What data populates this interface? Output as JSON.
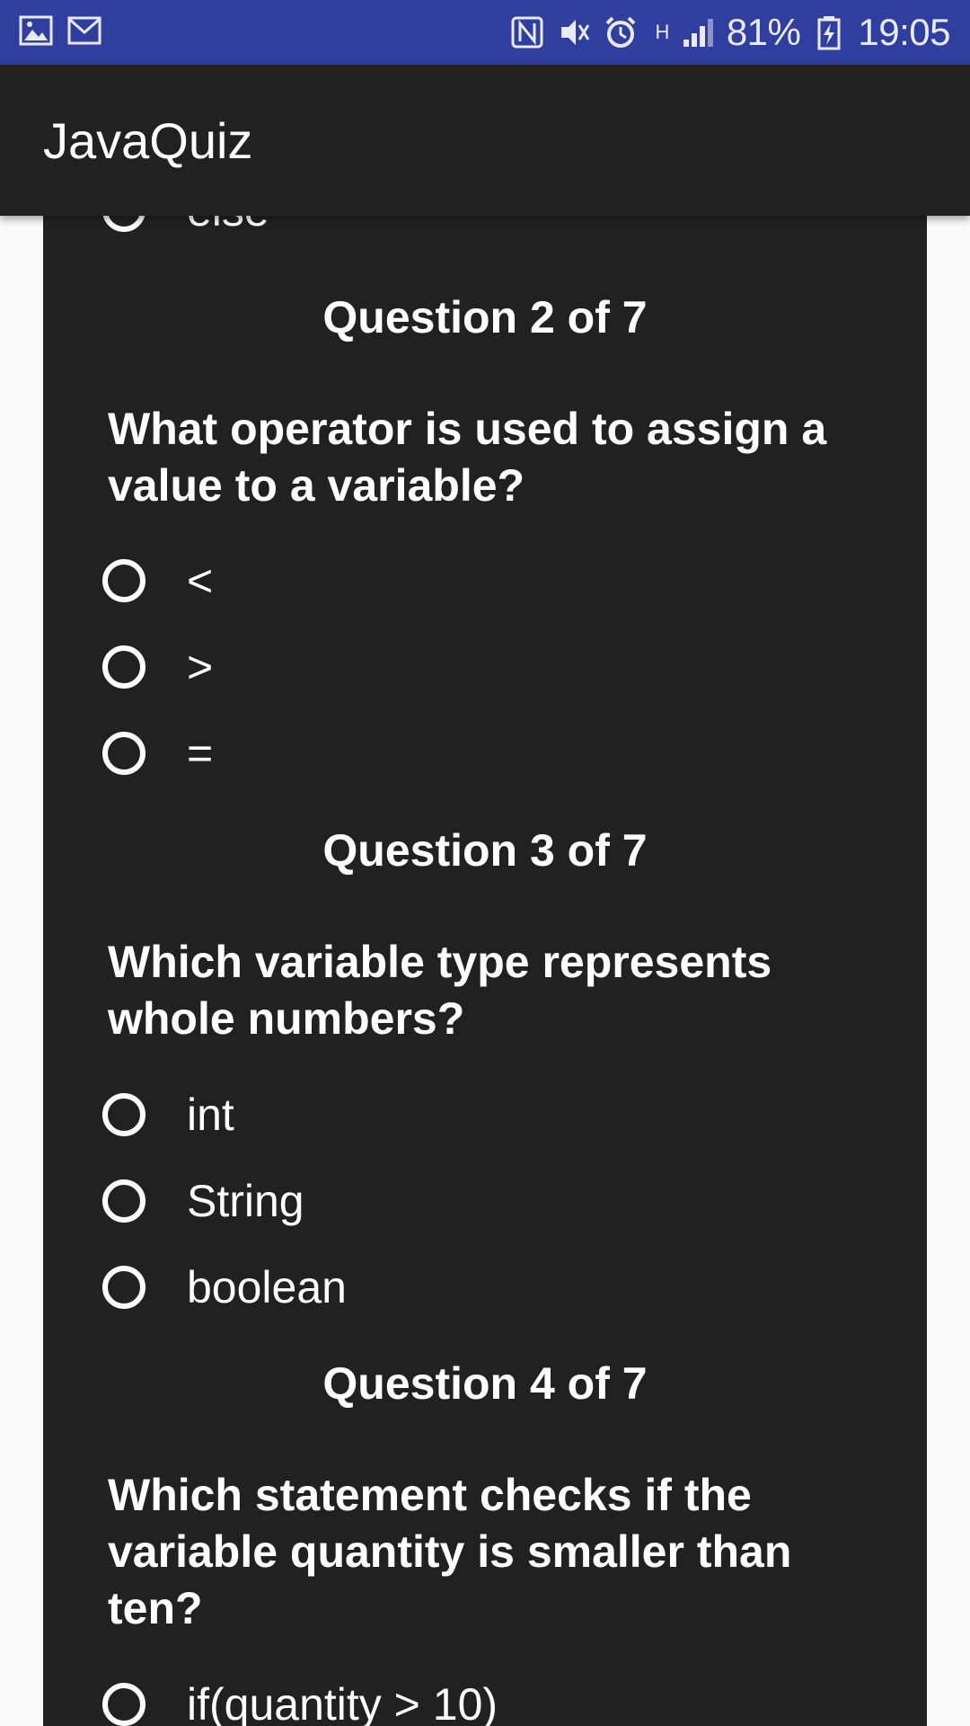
{
  "status_bar": {
    "battery": "81%",
    "time": "19:05",
    "network": "H"
  },
  "app": {
    "title": "JavaQuiz"
  },
  "questions": [
    {
      "partial_option": "else"
    },
    {
      "header": "Question 2 of 7",
      "text": "What operator is used to assign a value to a variable?",
      "options": [
        "<",
        ">",
        "="
      ]
    },
    {
      "header": "Question 3 of 7",
      "text": "Which variable type represents whole numbers?",
      "options": [
        "int",
        "String",
        "boolean"
      ]
    },
    {
      "header": "Question 4 of 7",
      "text": "Which statement checks if the variable quantity is smaller than ten?",
      "options": [
        "if(quantity > 10)"
      ]
    }
  ]
}
